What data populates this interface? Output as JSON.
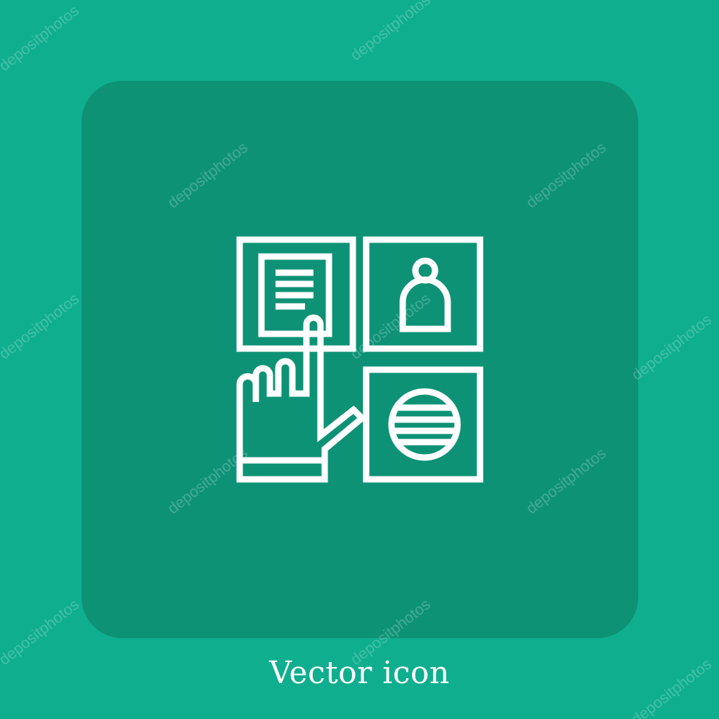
{
  "colors": {
    "background": "#0fae8e",
    "panel": "#0e9276",
    "icon_stroke": "#ffffff",
    "caption": "#ffffff",
    "watermark": "#ffffff"
  },
  "icon": {
    "name": "touch-screen-interface-icon",
    "parts": [
      "document-tile-icon",
      "user-tile-icon",
      "globe-tile-icon",
      "pointing-hand-icon"
    ]
  },
  "caption": {
    "text": "Vector icon"
  },
  "watermark": {
    "text": "depositphotos"
  }
}
